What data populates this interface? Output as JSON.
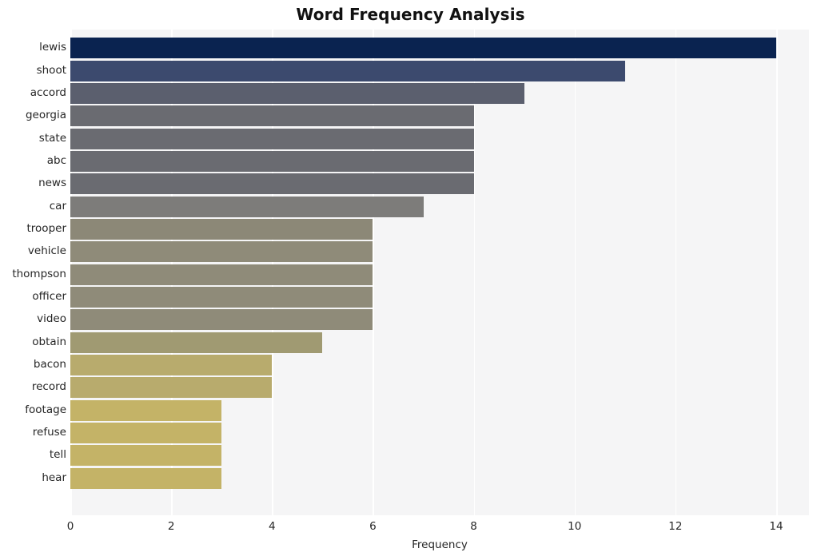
{
  "chart_data": {
    "type": "bar",
    "orientation": "horizontal",
    "title": "Word Frequency Analysis",
    "xlabel": "Frequency",
    "ylabel": "",
    "categories": [
      "lewis",
      "shoot",
      "accord",
      "georgia",
      "state",
      "abc",
      "news",
      "car",
      "trooper",
      "vehicle",
      "thompson",
      "officer",
      "video",
      "obtain",
      "bacon",
      "record",
      "footage",
      "refuse",
      "tell",
      "hear"
    ],
    "values": [
      14,
      11,
      9,
      8,
      8,
      8,
      8,
      7,
      6,
      6,
      6,
      6,
      6,
      5,
      4,
      4,
      3,
      3,
      3,
      3
    ],
    "bar_colors": [
      "#0a2350",
      "#3c4a6e",
      "#5b5f6e",
      "#6a6b71",
      "#6a6b71",
      "#6a6b71",
      "#6a6b71",
      "#7d7c7a",
      "#8c8877",
      "#8f8b79",
      "#8f8b79",
      "#8f8b79",
      "#8f8b79",
      "#a09a72",
      "#b8ab6d",
      "#b8ab6d",
      "#c4b367",
      "#c4b367",
      "#c4b367",
      "#c4b367"
    ],
    "xticks": [
      0,
      2,
      4,
      6,
      8,
      10,
      12,
      14
    ],
    "xtick_labels": [
      "0",
      "2",
      "4",
      "6",
      "8",
      "10",
      "12",
      "14"
    ],
    "xlim": [
      0,
      14.65
    ],
    "grid": true,
    "grid_axis": "both",
    "legend": false,
    "plot_background": "#f5f5f6",
    "grid_color": "#ffffff",
    "figure_background": "#ffffff",
    "text_color": "#262626",
    "title_color": "#111111"
  }
}
